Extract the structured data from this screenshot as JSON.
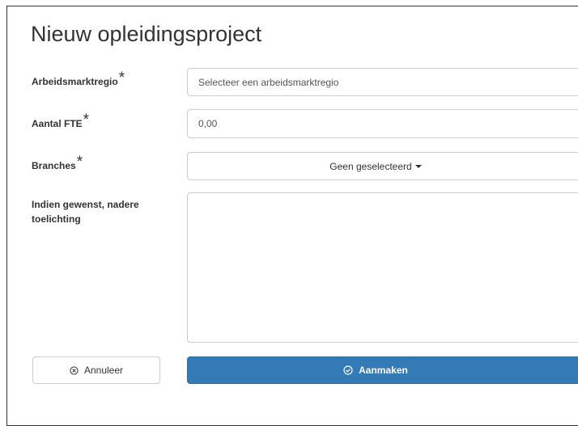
{
  "dialog": {
    "title": "Nieuw opleidingsproject"
  },
  "form": {
    "region": {
      "label": "Arbeidsmarktregio",
      "required_mark": "*",
      "placeholder": "Selecteer een arbeidsmarktregio"
    },
    "fte": {
      "label": "Aantal FTE",
      "required_mark": "*",
      "value": "0,00"
    },
    "branches": {
      "label": "Branches",
      "required_mark": "*",
      "selected": "Geen geselecteerd"
    },
    "notes": {
      "label": "Indien gewenst, nadere toelichting",
      "value": ""
    }
  },
  "actions": {
    "cancel_label": "Annuleer",
    "submit_label": "Aanmaken"
  },
  "colors": {
    "primary": "#337ab7",
    "border": "#cccccc",
    "text": "#333333"
  },
  "icons": {
    "cancel": "circle-x-icon",
    "submit": "circle-check-icon",
    "dropdown": "caret-down-icon"
  }
}
